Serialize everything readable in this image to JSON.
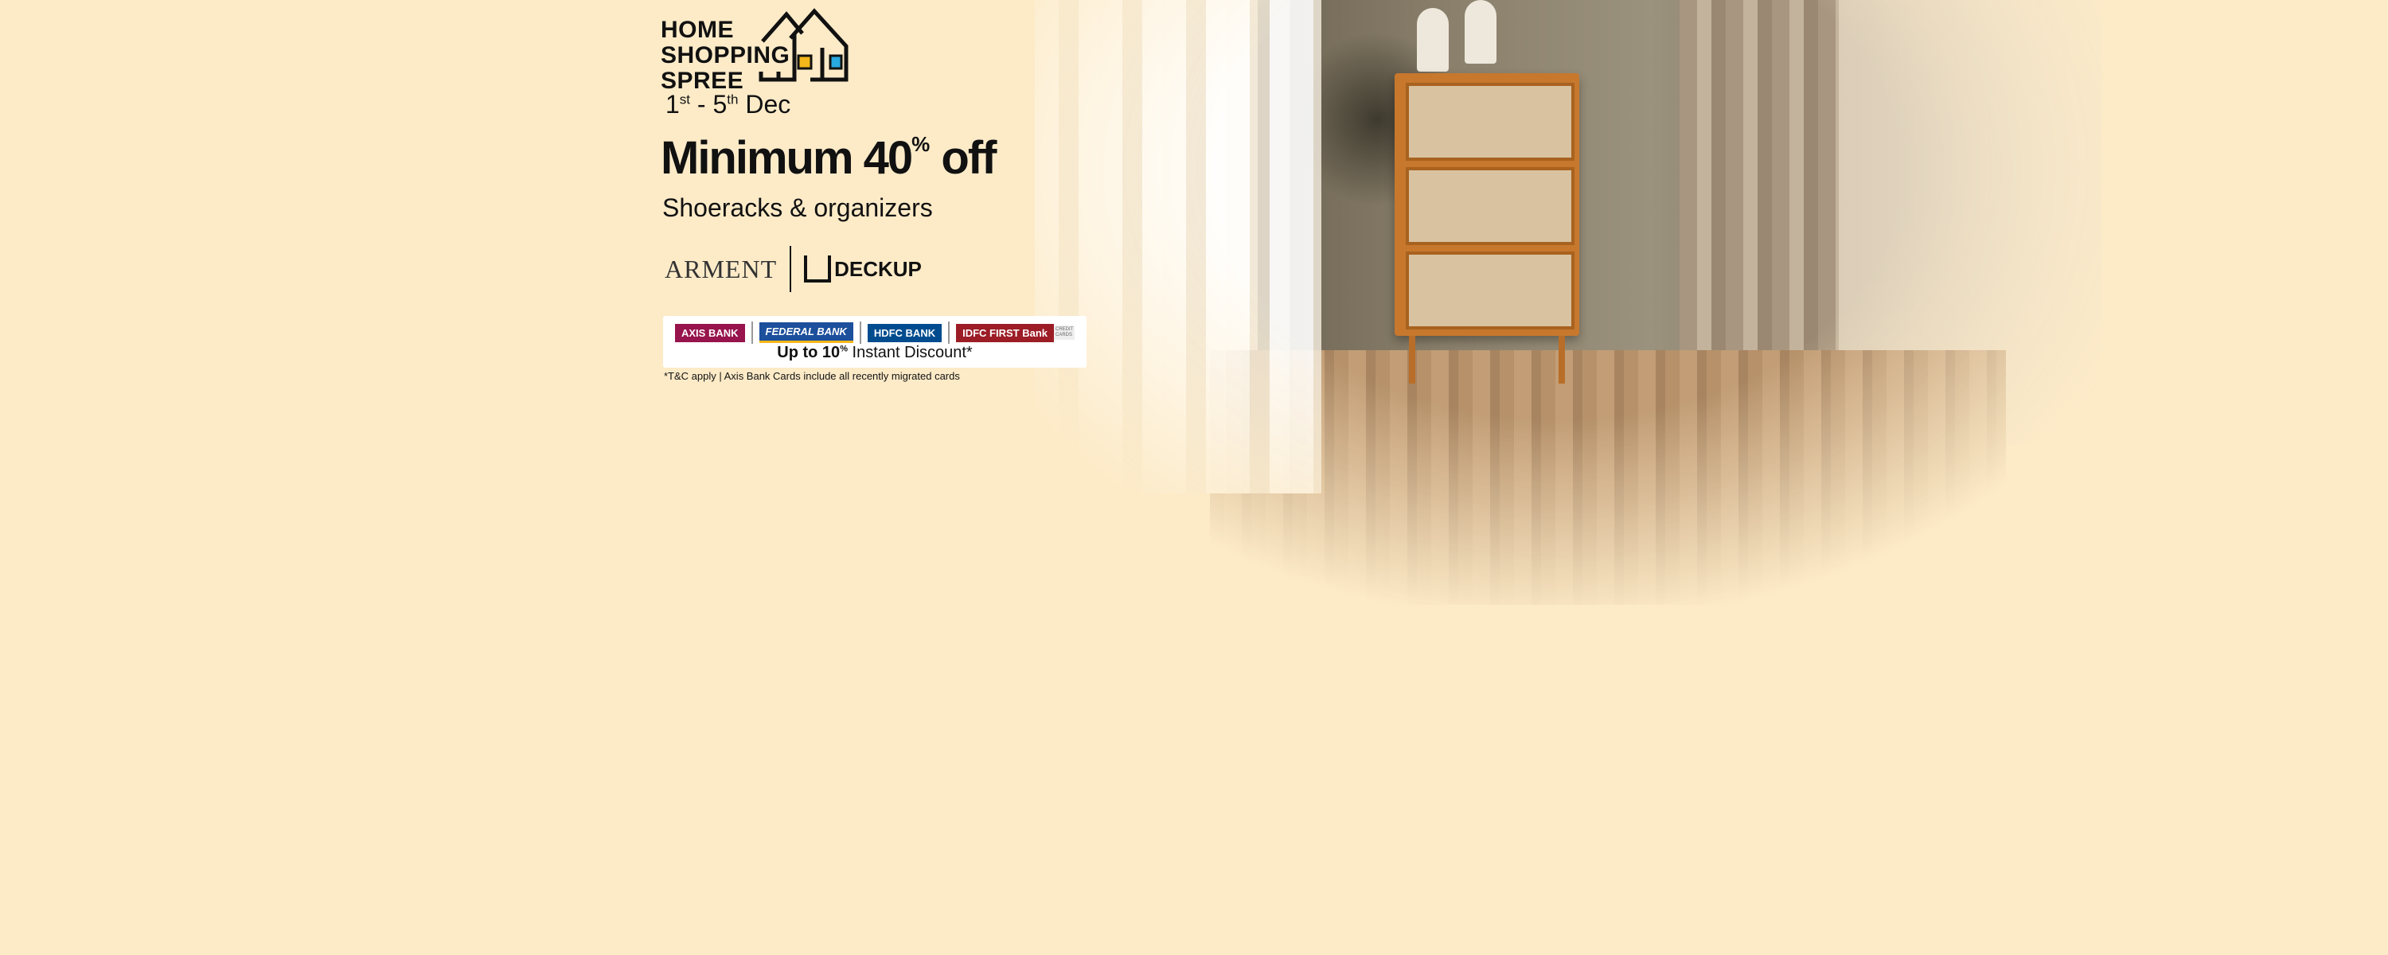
{
  "logo": {
    "line1": "HOME",
    "line2": "SHOPPING",
    "line3": "SPREE"
  },
  "date": {
    "start": "1",
    "start_suffix": "st",
    "sep": " - ",
    "end": "5",
    "end_suffix": "th",
    "month": " Dec"
  },
  "headline": {
    "prefix": "Minimum 40",
    "percent": "%",
    "suffix": " off"
  },
  "subtitle": "Shoeracks & organizers",
  "brands": [
    "ARMENT",
    "DECKUP"
  ],
  "banks": [
    {
      "name": "AXIS BANK",
      "color": "#97144d"
    },
    {
      "name": "FEDERAL BANK",
      "color": "#1c4f9c"
    },
    {
      "name": "HDFC BANK",
      "color": "#004c8f"
    },
    {
      "name": "IDFC FIRST Bank",
      "color": "#9c1d26"
    }
  ],
  "bank_badge": "CREDIT CARDS",
  "discount": {
    "bold": "Up to 10",
    "percent": "%",
    "rest": " Instant Discount*"
  },
  "footnote": "*T&C apply | Axis Bank Cards include all recently migrated cards"
}
